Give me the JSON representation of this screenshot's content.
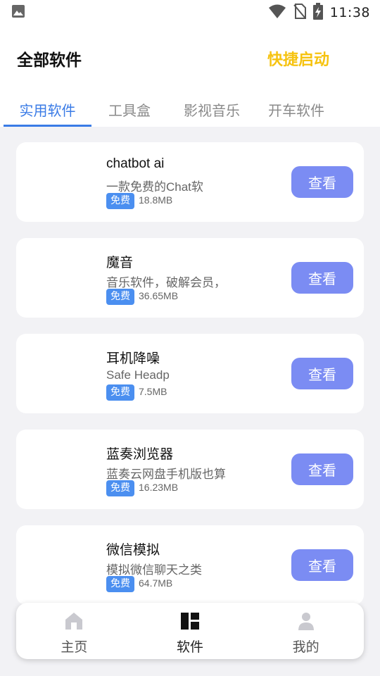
{
  "status_bar": {
    "time": "11:38",
    "icons": [
      "image-icon",
      "wifi-icon",
      "no-sim-icon",
      "battery-charging-icon"
    ]
  },
  "header": {
    "title": "全部软件",
    "quick_launch": "快捷启动"
  },
  "tabs": [
    {
      "label": "实用软件",
      "active": true
    },
    {
      "label": "工具盒",
      "active": false
    },
    {
      "label": "影视音乐",
      "active": false
    },
    {
      "label": "开车软件",
      "active": false
    }
  ],
  "apps": [
    {
      "name": "chatbot ai",
      "desc": "一款免费的Chat软",
      "badge": "免费",
      "size": "18.8MB",
      "button": "查看"
    },
    {
      "name": "魔音",
      "desc": "音乐软件，破解会员，",
      "badge": "免费",
      "size": "36.65MB",
      "button": "查看"
    },
    {
      "name": "耳机降噪",
      "desc": "Safe Headp",
      "badge": "免费",
      "size": "7.5MB",
      "button": "查看"
    },
    {
      "name": "蓝奏浏览器",
      "desc": "蓝奏云网盘手机版也算",
      "badge": "免费",
      "size": "16.23MB",
      "button": "查看"
    },
    {
      "name": "微信模拟",
      "desc": "模拟微信聊天之类",
      "badge": "免费",
      "size": "64.7MB",
      "button": "查看"
    }
  ],
  "bottom_nav": [
    {
      "label": "主页",
      "icon": "home-icon",
      "active": false
    },
    {
      "label": "软件",
      "icon": "dashboard-icon",
      "active": true
    },
    {
      "label": "我的",
      "icon": "person-icon",
      "active": false
    }
  ],
  "colors": {
    "accent": "#3a7be6",
    "quick_launch": "#f6c310",
    "button": "#7b8cf3",
    "badge": "#4b8ff0",
    "background": "#f2f2f5"
  }
}
